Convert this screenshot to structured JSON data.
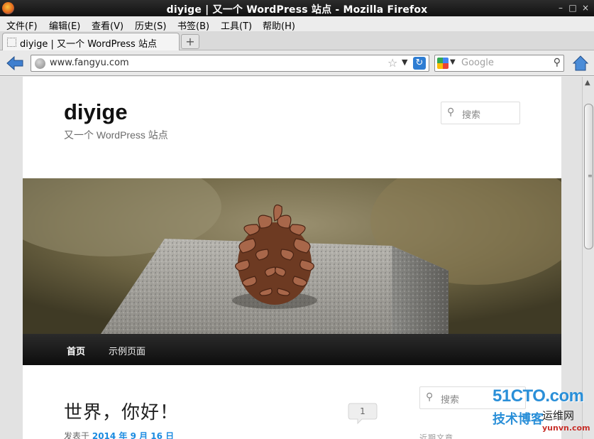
{
  "window": {
    "title": "diyige | 又一个 WordPress 站点 - Mozilla Firefox",
    "minimize": "–",
    "maximize": "□",
    "close": "×"
  },
  "menu": [
    "文件(F)",
    "编辑(E)",
    "查看(V)",
    "历史(S)",
    "书签(B)",
    "工具(T)",
    "帮助(H)"
  ],
  "tabs": [
    {
      "label": "diyige | 又一个 WordPress 站点"
    }
  ],
  "new_tab": "+",
  "urlbar": {
    "url": "www.fangyu.com"
  },
  "searchbar": {
    "placeholder": "Google"
  },
  "site": {
    "title": "diyige",
    "description": "又一个 WordPress 站点",
    "header_search_placeholder": "搜索",
    "nav": [
      "首页",
      "示例页面"
    ],
    "post": {
      "title": "世界，你好！",
      "comment_count": "1",
      "meta_prefix": "发表于",
      "date": "2014 年 9 月 16 日"
    },
    "sidebar_search_placeholder": "搜索",
    "sidebar_heading": "近期文章"
  },
  "watermark": {
    "brand": "51CTO.com",
    "tech_blog": "技术博客",
    "ops_net": "运维网",
    "domain": "yunvn.com"
  },
  "colors": {
    "link_blue": "#1b8be0",
    "nav_bg": "#111111",
    "watermark_blue": "#2a8fd8"
  }
}
